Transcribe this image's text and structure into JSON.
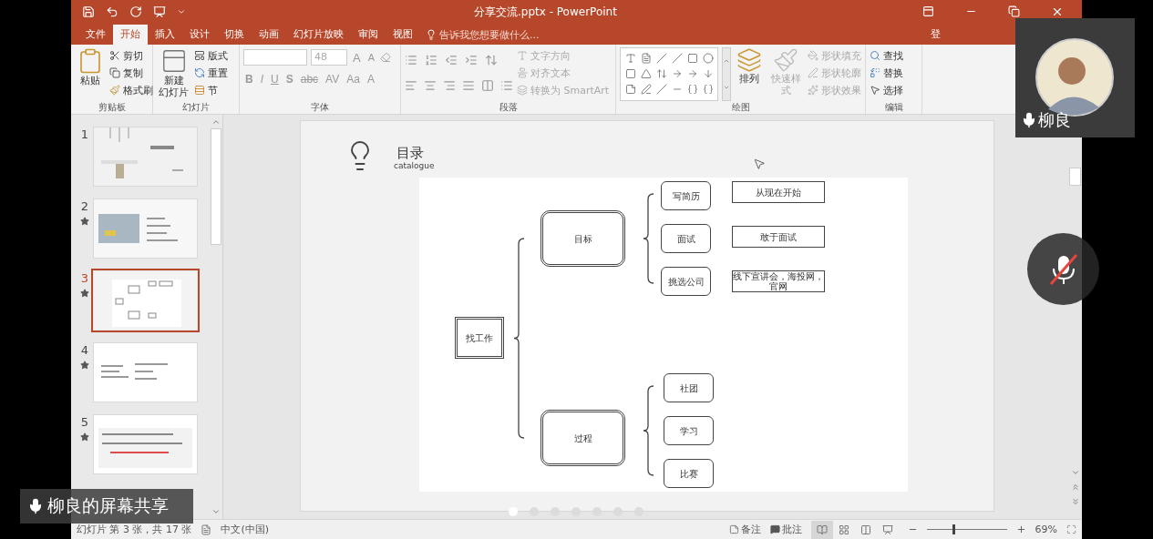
{
  "window": {
    "title": "分享交流.pptx - PowerPoint",
    "sign_in": "登"
  },
  "menu_tabs": [
    {
      "label": "文件",
      "selected": false
    },
    {
      "label": "开始",
      "selected": true
    },
    {
      "label": "插入",
      "selected": false
    },
    {
      "label": "设计",
      "selected": false
    },
    {
      "label": "切换",
      "selected": false
    },
    {
      "label": "动画",
      "selected": false
    },
    {
      "label": "幻灯片放映",
      "selected": false
    },
    {
      "label": "审阅",
      "selected": false
    },
    {
      "label": "视图",
      "selected": false
    }
  ],
  "tell_me": {
    "placeholder": "告诉我您想要做什么..."
  },
  "ribbon_groups": [
    {
      "kind": "clipboard",
      "label": "剪贴板",
      "big": {
        "lines": [
          "粘贴"
        ],
        "disabled": false
      },
      "items": [
        {
          "kind": "cut",
          "label": "剪切",
          "disabled": false
        },
        {
          "kind": "copy",
          "label": "复制",
          "disabled": false
        },
        {
          "kind": "format",
          "label": "格式刷",
          "disabled": false
        }
      ]
    },
    {
      "kind": "slides",
      "label": "幻灯片",
      "big": {
        "lines": [
          "新建",
          "幻灯片"
        ],
        "disabled": false
      },
      "items": [
        {
          "kind": "layout",
          "label": "版式",
          "disabled": false
        },
        {
          "kind": "reset",
          "label": "重置",
          "disabled": false
        },
        {
          "kind": "section",
          "label": "节",
          "disabled": false
        }
      ]
    },
    {
      "kind": "font",
      "label": "字体",
      "size": {
        "value": "48"
      },
      "size_buttons": [
        "A",
        "A"
      ],
      "buttons": [
        "B",
        "I",
        "U",
        "S",
        "abc",
        "AV",
        "Aa",
        "A"
      ],
      "disabled": true
    },
    {
      "kind": "paragraph",
      "label": "段落",
      "items": [
        {
          "kind": "direction",
          "label": "文字方向",
          "disabled": true
        },
        {
          "kind": "align",
          "label": "对齐文本",
          "disabled": true
        },
        {
          "kind": "smartart",
          "label": "转换为 SmartArt",
          "disabled": true
        }
      ]
    },
    {
      "kind": "drawing",
      "label": "绘图",
      "big": [
        {
          "label": "排列",
          "disabled": false
        },
        {
          "label": "快速样式",
          "disabled": true
        }
      ],
      "items": [
        {
          "kind": "fill",
          "label": "形状填充",
          "disabled": true
        },
        {
          "kind": "outline",
          "label": "形状轮廓",
          "disabled": true
        },
        {
          "kind": "effect",
          "label": "形状效果",
          "disabled": true
        }
      ]
    },
    {
      "kind": "editing",
      "label": "编辑",
      "items": [
        {
          "kind": "find",
          "label": "查找",
          "disabled": false
        },
        {
          "kind": "replace",
          "label": "替换",
          "disabled": false
        },
        {
          "kind": "select",
          "label": "选择",
          "disabled": false
        }
      ]
    }
  ],
  "thumbnails": [
    {
      "number": "1",
      "selected": false,
      "animated": false,
      "kind": "title"
    },
    {
      "number": "2",
      "selected": false,
      "animated": true,
      "kind": "photo"
    },
    {
      "number": "3",
      "selected": true,
      "animated": true,
      "kind": "diagram"
    },
    {
      "number": "4",
      "selected": false,
      "animated": true,
      "kind": "text"
    },
    {
      "number": "5",
      "selected": false,
      "animated": true,
      "kind": "list"
    }
  ],
  "slide": {
    "title": "目录",
    "subtitle": "catalogue",
    "diagram": {
      "label": "找工作",
      "children": [
        {
          "label": "目标",
          "children": [
            {
              "label": "写简历",
              "note": "从现在开始"
            },
            {
              "label": "面试",
              "note": "敢于面试"
            },
            {
              "label": "挑选公司",
              "note": "线下宣讲会，海投网，官网"
            }
          ]
        },
        {
          "label": "过程",
          "children": [
            {
              "label": "社团"
            },
            {
              "label": "学习"
            },
            {
              "label": "比赛"
            }
          ]
        }
      ]
    }
  },
  "status_bar": {
    "slide_info": "幻灯片 第 3 张，共 17 张",
    "language": "中文(中国)",
    "notes": "备注",
    "comments": "批注",
    "views": [
      {
        "selected": true
      },
      {
        "selected": false
      },
      {
        "selected": false
      },
      {
        "selected": false
      }
    ],
    "zoom": {
      "level": 0.32,
      "reading": "69%"
    }
  },
  "call": {
    "name": "柳良",
    "share_label": "柳良的屏幕共享",
    "muted": true,
    "page_dots": [
      {
        "selected": true
      },
      {
        "selected": false
      },
      {
        "selected": false
      },
      {
        "selected": false
      },
      {
        "selected": false
      },
      {
        "selected": false
      },
      {
        "selected": false
      }
    ]
  }
}
